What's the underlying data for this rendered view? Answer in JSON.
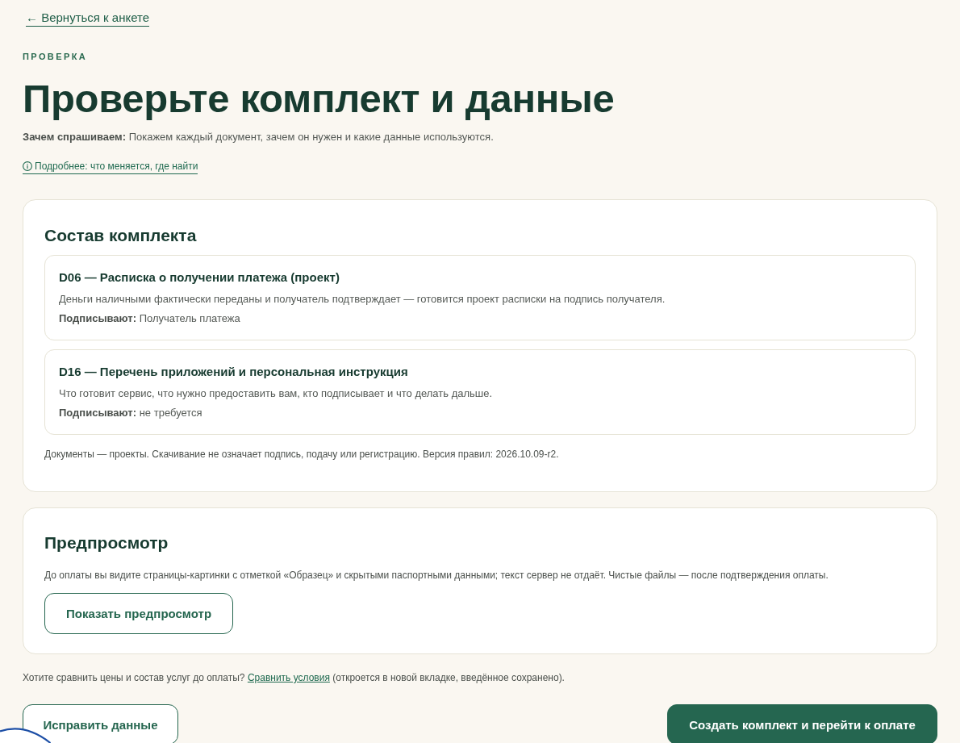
{
  "back_link": {
    "label": "← Вернуться к анкете"
  },
  "eyebrow": "ПРОВЕРКА",
  "title": "Проверьте комплект и данные",
  "intro": "**Зачем спрашиваем:** Покажем каждый документ, зачем он нужен и какие данные используются.",
  "info_link": {
    "label": "Подробнее: что меняется, где найти"
  },
  "contents_card": {
    "heading": "Состав комплекта",
    "documents": [
      {
        "title": "D06 — Расписка о получении платежа (проект)",
        "description": "Деньги наличными фактически переданы и получатель подтверждает — готовится проект расписки на подпись получателя.",
        "signers": "**Подписывают:** Получатель платежа"
      },
      {
        "title": "D16 — Перечень приложений и персональная инструкция",
        "description": "Что готовит сервис, что нужно предоставить вам, кто подписывает и что делать дальше.",
        "signers": "**Подписывают:** не требуется"
      }
    ],
    "note": "Документы — проекты. Скачивание не означает подпись, подачу или регистрацию. Версия правил: 2026.10.09-r2."
  },
  "preview_card": {
    "heading": "Предпросмотр",
    "text": "До оплаты вы видите страницы-картинки с отметкой «Образец» и скрытыми паспортными данными; текст сервер не отдаёт. Чистые файлы — после подтверждения оплаты.",
    "button": "Показать предпросмотр"
  },
  "compare_note": {
    "before": "Хотите сравнить цены и состав услуг до оплаты?",
    "link": "Сравнить условия",
    "after": "(откроется в новой вкладке, введённое сохранено)."
  },
  "actions": [
    {
      "label": "Исправить данные",
      "kind": "secondary"
    },
    {
      "label": "Создать комплект и перейти к оплате",
      "kind": "primary"
    }
  ]
}
